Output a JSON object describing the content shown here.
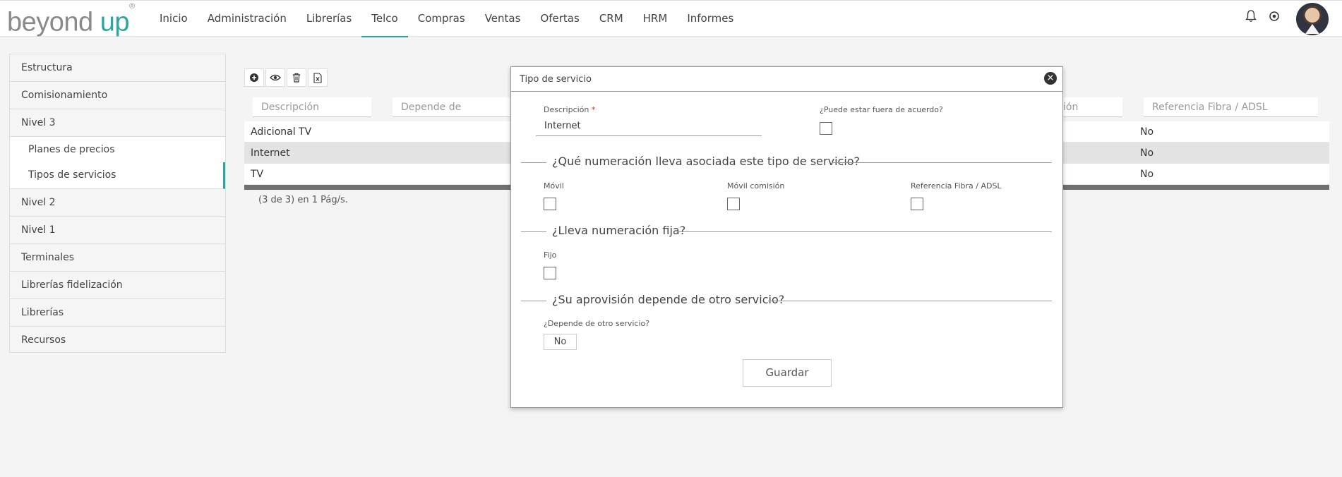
{
  "logo": {
    "part1": "beyond",
    "part2": "up",
    "mark": "®"
  },
  "nav": {
    "items": [
      "Inicio",
      "Administración",
      "Librerías",
      "Telco",
      "Compras",
      "Ventas",
      "Ofertas",
      "CRM",
      "HRM",
      "Informes"
    ],
    "active": "Telco"
  },
  "header_icons": [
    "bell-icon",
    "user-menu-icon"
  ],
  "sidebar": {
    "items": [
      {
        "label": "Estructura"
      },
      {
        "label": "Comisionamiento"
      },
      {
        "label": "Nivel 3"
      },
      {
        "label": "Planes de precios"
      },
      {
        "label": "Tipos de servicios"
      },
      {
        "label": "Nivel 2"
      },
      {
        "label": "Nivel 1"
      },
      {
        "label": "Terminales"
      },
      {
        "label": "Librerías fidelización"
      },
      {
        "label": "Librerías"
      },
      {
        "label": "Recursos"
      }
    ],
    "active": "Tipos de servicios"
  },
  "toolbar": {
    "icons": [
      "add-icon",
      "view-icon",
      "delete-icon",
      "excel-export-icon"
    ]
  },
  "table": {
    "filters": {
      "descripcion": "Descripción",
      "depende_de": "Depende de",
      "comision_partial": "ión",
      "referencia": "Referencia Fibra / ADSL"
    },
    "rows": [
      {
        "descripcion": "Adicional TV",
        "referencia": "No"
      },
      {
        "descripcion": "Internet",
        "referencia": "No",
        "selected": true
      },
      {
        "descripcion": "TV",
        "referencia": "No"
      }
    ],
    "pager": "(3 de 3) en 1 Pág/s."
  },
  "modal": {
    "title": "Tipo de servicio",
    "descripcion_label": "Descripción",
    "required_mark": "*",
    "descripcion_value": "Internet",
    "fuera_acuerdo_label": "¿Puede estar fuera de acuerdo?",
    "section_numeracion": "¿Qué numeración lleva asociada este tipo de servicio?",
    "movil_label": "Móvil",
    "movil_comision_label": "Móvil comisión",
    "referencia_label": "Referencia Fibra / ADSL",
    "section_fija": "¿Lleva numeración fija?",
    "fijo_label": "Fijo",
    "section_aprovision": "¿Su aprovisión depende de otro servicio?",
    "depende_label": "¿Depende de otro servicio?",
    "depende_value": "No",
    "save_label": "Guardar"
  }
}
